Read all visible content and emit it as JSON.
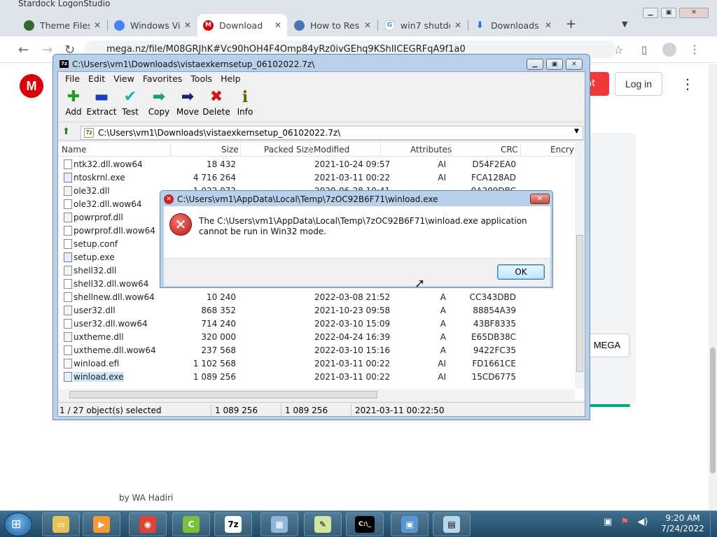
{
  "browser": {
    "window_title": "Stardock LogonStudio",
    "tabs": [
      {
        "label": "Theme Files",
        "icon": "globe-icon",
        "color": "#2e6b2e"
      },
      {
        "label": "Windows Vi",
        "icon": "chrome-icon",
        "color": "#4285f4"
      },
      {
        "label": "Download",
        "icon": "mega-icon",
        "color": "#d90007",
        "active": true
      },
      {
        "label": "How to Res",
        "icon": "circle-blue-icon",
        "color": "#4a72b8"
      },
      {
        "label": "win7 shutdo",
        "icon": "google-icon",
        "color": "#4285f4"
      },
      {
        "label": "Downloads",
        "icon": "download-icon",
        "color": "#1a73e8"
      }
    ],
    "url": "mega.nz/file/M08GRJhK#Vc90hOH4F4Omp84yRz0ivGEhq9KShIICEGRFqA9f1a0",
    "new_tab": "+",
    "tab_close": "✕"
  },
  "mega": {
    "logo_letter": "M",
    "red_button": "nt",
    "login": "Log in",
    "side_button": "MEGA",
    "footer_text": "by WA Hadiri"
  },
  "sevenzip": {
    "title": "C:\\Users\\vm1\\Downloads\\vistaexkernsetup_06102022.7z\\",
    "icon_text": "7z",
    "menu": [
      "File",
      "Edit",
      "View",
      "Favorites",
      "Tools",
      "Help"
    ],
    "toolbar": [
      {
        "label": "Add",
        "icon": "add-icon",
        "glyph": "✚",
        "color": "#1ea01e"
      },
      {
        "label": "Extract",
        "icon": "extract-icon",
        "glyph": "▬",
        "color": "#1d3fb8"
      },
      {
        "label": "Test",
        "icon": "test-icon",
        "glyph": "✔",
        "color": "#1ab2b2"
      },
      {
        "label": "Copy",
        "icon": "copy-icon",
        "glyph": "➡",
        "color": "#1c9a7a"
      },
      {
        "label": "Move",
        "icon": "move-icon",
        "glyph": "➡",
        "color": "#14237a"
      },
      {
        "label": "Delete",
        "icon": "delete-icon",
        "glyph": "✖",
        "color": "#d4141a"
      },
      {
        "label": "Info",
        "icon": "info-icon",
        "glyph": "i",
        "color": "#6b5a00"
      }
    ],
    "path": "C:\\Users\\vm1\\Downloads\\vistaexkernsetup_06102022.7z\\",
    "columns": [
      "Name",
      "Size",
      "Packed Size",
      "Modified",
      "Attributes",
      "CRC",
      "Encry"
    ],
    "rows": [
      {
        "name": "ntk32.dll.wow64",
        "size": "18 432",
        "modified": "2021-10-24 09:57",
        "attr": "AI",
        "crc": "D54F2EA0",
        "type": "file"
      },
      {
        "name": "ntoskrnl.exe",
        "size": "4 716 264",
        "modified": "2021-03-11 00:22",
        "attr": "AI",
        "crc": "FCA128AD",
        "type": "exe"
      },
      {
        "name": "ole32.dll",
        "size": "1 022 072",
        "modified": "2020-06-28 10:41",
        "attr": "",
        "crc": "0A209DBC",
        "type": "dll"
      },
      {
        "name": "ole32.dll.wow64",
        "size": "",
        "modified": "",
        "attr": "",
        "crc": "",
        "type": "file"
      },
      {
        "name": "powrprof.dll",
        "size": "",
        "modified": "",
        "attr": "",
        "crc": "",
        "type": "dll"
      },
      {
        "name": "powrprof.dll.wow64",
        "size": "",
        "modified": "",
        "attr": "",
        "crc": "",
        "type": "file"
      },
      {
        "name": "setup.conf",
        "size": "",
        "modified": "",
        "attr": "",
        "crc": "",
        "type": "file"
      },
      {
        "name": "setup.exe",
        "size": "",
        "modified": "",
        "attr": "",
        "crc": "",
        "type": "exe"
      },
      {
        "name": "shell32.dll",
        "size": "",
        "modified": "",
        "attr": "",
        "crc": "",
        "type": "dll"
      },
      {
        "name": "shell32.dll.wow64",
        "size": "",
        "modified": "",
        "attr": "",
        "crc": "",
        "type": "file"
      },
      {
        "name": "shellnew.dll.wow64",
        "size": "10 240",
        "modified": "2022-03-08 21:52",
        "attr": "A",
        "crc": "CC343DBD",
        "type": "file"
      },
      {
        "name": "user32.dll",
        "size": "868 352",
        "modified": "2021-10-23 09:58",
        "attr": "A",
        "crc": "88854A39",
        "type": "dll"
      },
      {
        "name": "user32.dll.wow64",
        "size": "714 240",
        "modified": "2022-03-10 15:09",
        "attr": "A",
        "crc": "43BF8335",
        "type": "file"
      },
      {
        "name": "uxtheme.dll",
        "size": "320 000",
        "modified": "2022-04-24 16:39",
        "attr": "A",
        "crc": "E65DB38C",
        "type": "dll"
      },
      {
        "name": "uxtheme.dll.wow64",
        "size": "237 568",
        "modified": "2022-03-10 15:16",
        "attr": "A",
        "crc": "9422FC35",
        "type": "file"
      },
      {
        "name": "winload.efi",
        "size": "1 102 568",
        "modified": "2021-03-11 00:22",
        "attr": "AI",
        "crc": "FD1661CE",
        "type": "file"
      },
      {
        "name": "winload.exe",
        "size": "1 089 256",
        "modified": "2021-03-11 00:22",
        "attr": "AI",
        "crc": "15CD6775",
        "type": "exe",
        "selected": true
      }
    ],
    "status": {
      "selection": "1 / 27 object(s) selected",
      "size": "1 089 256",
      "packed": "1 089 256",
      "modified": "2021-03-11 00:22:50"
    }
  },
  "error_dialog": {
    "title": "C:\\Users\\vm1\\AppData\\Local\\Temp\\7zOC92B6F71\\winload.exe",
    "message": "The C:\\Users\\vm1\\AppData\\Local\\Temp\\7zOC92B6F71\\winload.exe application cannot be run in Win32 mode.",
    "ok": "OK"
  },
  "taskbar": {
    "items": [
      {
        "name": "explorer",
        "icon": "folder-icon",
        "color": "#e7c25a",
        "glyph": "▭"
      },
      {
        "name": "media-player",
        "icon": "media-player-icon",
        "color": "#f39c34",
        "glyph": "▶"
      },
      {
        "name": "chrome",
        "icon": "chrome-icon",
        "color": "#db4437",
        "glyph": "◉"
      },
      {
        "name": "ccleaner",
        "icon": "ccleaner-icon",
        "color": "#7cbf3a",
        "glyph": "C"
      },
      {
        "name": "7zip",
        "icon": "7zip-icon",
        "color": "#ffffff",
        "glyph": "7z"
      },
      {
        "name": "control-panel",
        "icon": "control-panel-icon",
        "color": "#8fb7d8",
        "glyph": "▦"
      },
      {
        "name": "editor",
        "icon": "editor-icon",
        "color": "#cfe7a1",
        "glyph": "✎"
      },
      {
        "name": "cmd",
        "icon": "cmd-icon",
        "color": "#000000",
        "glyph": "C:\\_"
      },
      {
        "name": "window",
        "icon": "window-icon",
        "color": "#5a95cf",
        "glyph": "▣"
      },
      {
        "name": "file",
        "icon": "file-icon",
        "color": "#b9d7e8",
        "glyph": "▤"
      }
    ],
    "time": "9:20 AM",
    "date": "7/24/2022"
  }
}
